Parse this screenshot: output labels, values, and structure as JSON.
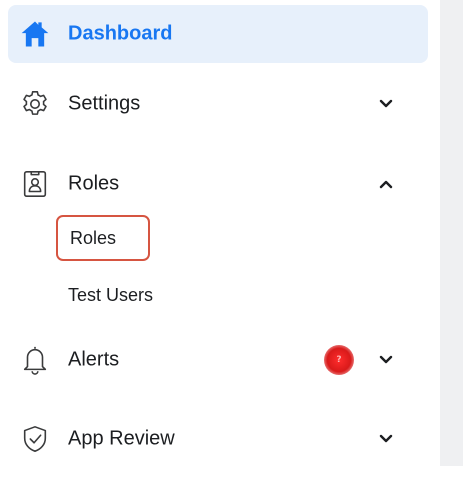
{
  "sidebar": {
    "items": [
      {
        "label": "Dashboard",
        "icon": "home-icon",
        "active": true
      },
      {
        "label": "Settings",
        "icon": "gear-icon",
        "expand": "chevron-down-icon"
      },
      {
        "label": "Roles",
        "icon": "roles-badge-icon",
        "expand": "chevron-up-icon",
        "children": [
          {
            "label": "Roles",
            "highlighted": true
          },
          {
            "label": "Test Users"
          }
        ]
      },
      {
        "label": "Alerts",
        "icon": "bell-icon",
        "expand": "chevron-down-icon",
        "badge": "?"
      },
      {
        "label": "App Review",
        "icon": "shield-check-icon",
        "expand": "chevron-down-icon"
      }
    ]
  },
  "colors": {
    "accent": "#1877f2",
    "active_bg": "#e7f0fb",
    "highlight_border": "#d65541",
    "badge": "#e02424",
    "right_pane": "#eff0f2"
  }
}
